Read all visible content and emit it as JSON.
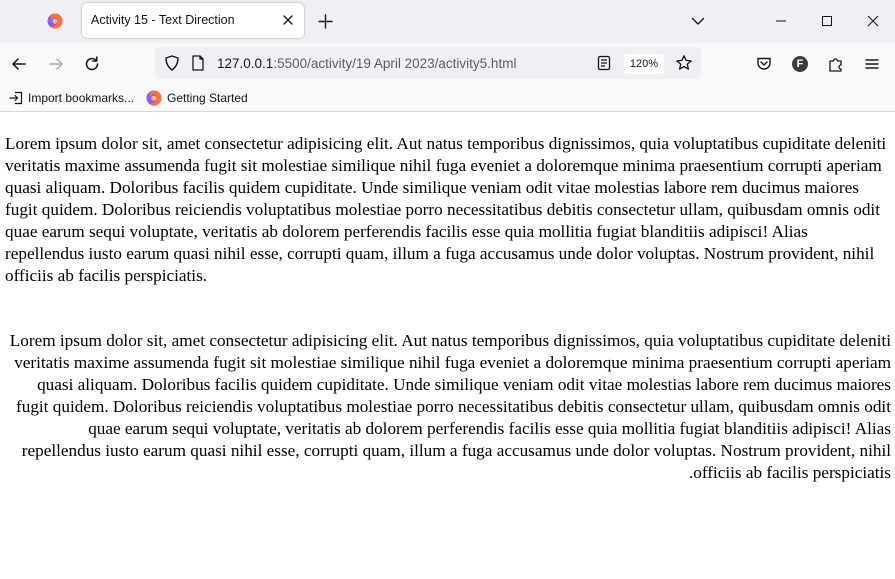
{
  "browser": {
    "tab": {
      "title": "Activity 15 - Text Direction"
    },
    "url": {
      "host": "127.0.0.1",
      "path": ":5500/activity/19 April 2023/activity5.html"
    },
    "zoom": "120%",
    "profile_initial": "F",
    "bookmarks": [
      "Import bookmarks...",
      "Getting Started"
    ],
    "colors": {
      "firefox_orange": "#ff7139",
      "firefox_purple": "#9059ff"
    }
  },
  "page": {
    "paragraph_ltr": "Lorem ipsum dolor sit, amet consectetur adipisicing elit. Aut natus temporibus dignissimos, quia voluptatibus cupiditate deleniti veritatis maxime assumenda fugit sit molestiae similique nihil fuga eveniet a doloremque minima praesentium corrupti aperiam quasi aliquam. Doloribus facilis quidem cupiditate. Unde similique veniam odit vitae molestias labore rem ducimus maiores fugit quidem. Doloribus reiciendis voluptatibus molestiae porro necessitatibus debitis consectetur ullam, quibusdam omnis odit quae earum sequi voluptate, veritatis ab dolorem perferendis facilis esse quia mollitia fugiat blanditiis adipisci! Alias repellendus iusto earum quasi nihil esse, corrupti quam, illum a fuga accusamus unde dolor voluptas. Nostrum provident, nihil officiis ab facilis perspiciatis.",
    "paragraph_rtl": "Lorem ipsum dolor sit, amet consectetur adipisicing elit. Aut natus temporibus dignissimos, quia voluptatibus cupiditate deleniti veritatis maxime assumenda fugit sit molestiae similique nihil fuga eveniet a doloremque minima praesentium corrupti aperiam quasi aliquam. Doloribus facilis quidem cupiditate. Unde similique veniam odit vitae molestias labore rem ducimus maiores fugit quidem. Doloribus reiciendis voluptatibus molestiae porro necessitatibus debitis consectetur ullam, quibusdam omnis odit quae earum sequi voluptate, veritatis ab dolorem perferendis facilis esse quia mollitia fugiat blanditiis adipisci! Alias repellendus iusto earum quasi nihil esse, corrupti quam, illum a fuga accusamus unde dolor voluptas. Nostrum provident, nihil officiis ab facilis perspiciatis."
  }
}
